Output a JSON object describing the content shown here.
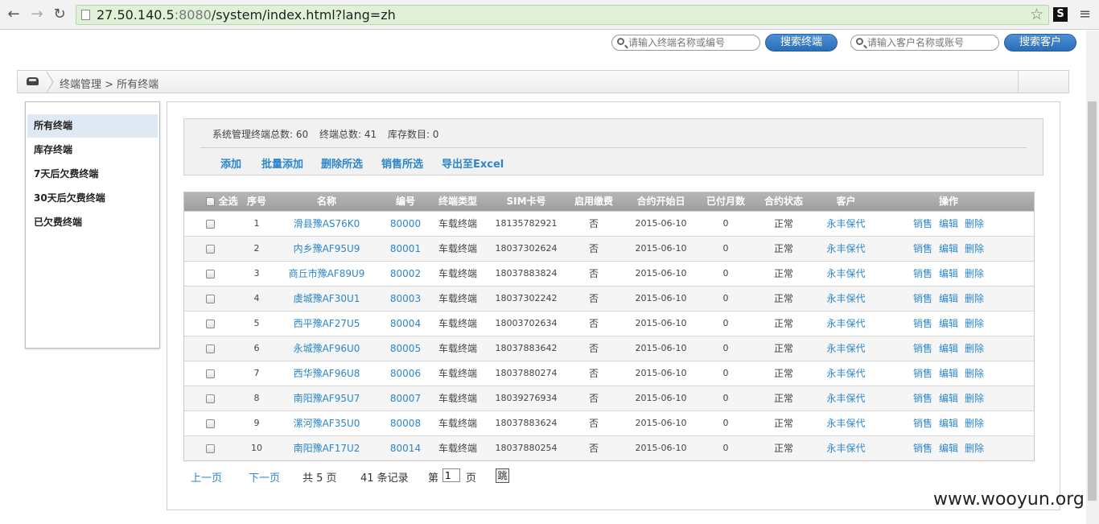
{
  "browser": {
    "url_host": "27.50.140.5",
    "url_port": ":8080",
    "url_path": "/system/index.html?lang=zh",
    "back": "←",
    "forward": "→",
    "reload": "↻",
    "star": "☆",
    "ext": "S",
    "menu": "≡"
  },
  "search": {
    "terminal_placeholder": "请输入终端名称或编号",
    "terminal_button": "搜索终端",
    "customer_placeholder": "请输入客户名称或账号",
    "customer_button": "搜索客户"
  },
  "breadcrumb": {
    "text": "终端管理 > 所有终端"
  },
  "sidebar": {
    "items": [
      {
        "label": "所有终端",
        "active": true
      },
      {
        "label": "库存终端"
      },
      {
        "label": "7天后欠费终端"
      },
      {
        "label": "30天后欠费终端"
      },
      {
        "label": "已欠费终端"
      }
    ]
  },
  "stats": {
    "managed_total": "系统管理终端总数: 60",
    "terminal_total": "终端总数: 41",
    "stock_total": "库存数目: 0"
  },
  "actions": [
    "添加",
    "批量添加",
    "删除所选",
    "销售所选",
    "导出至Excel"
  ],
  "table": {
    "headers": [
      "全选",
      "序号",
      "名称",
      "编号",
      "终端类型",
      "SIM卡号",
      "启用缴费",
      "合约开始日",
      "已付月数",
      "合约状态",
      "客户",
      "操作"
    ],
    "row_ops": [
      "销售",
      "编辑",
      "删除"
    ],
    "rows": [
      [
        "1",
        "滑县豫AS76K0",
        "80000",
        "车载终端",
        "18135782921",
        "否",
        "2015-06-10",
        "0",
        "正常",
        "永丰保代"
      ],
      [
        "2",
        "内乡豫AF95U9",
        "80001",
        "车载终端",
        "18037302624",
        "否",
        "2015-06-10",
        "0",
        "正常",
        "永丰保代"
      ],
      [
        "3",
        "商丘市豫AF89U9",
        "80002",
        "车载终端",
        "18037883824",
        "否",
        "2015-06-10",
        "0",
        "正常",
        "永丰保代"
      ],
      [
        "4",
        "虞城豫AF30U1",
        "80003",
        "车载终端",
        "18037302242",
        "否",
        "2015-06-10",
        "0",
        "正常",
        "永丰保代"
      ],
      [
        "5",
        "西平豫AF27U5",
        "80004",
        "车载终端",
        "18003702634",
        "否",
        "2015-06-10",
        "0",
        "正常",
        "永丰保代"
      ],
      [
        "6",
        "永城豫AF96U0",
        "80005",
        "车载终端",
        "18037883642",
        "否",
        "2015-06-10",
        "0",
        "正常",
        "永丰保代"
      ],
      [
        "7",
        "西华豫AF96U8",
        "80006",
        "车载终端",
        "18037880274",
        "否",
        "2015-06-10",
        "0",
        "正常",
        "永丰保代"
      ],
      [
        "8",
        "南阳豫AF95U7",
        "80007",
        "车载终端",
        "18039276934",
        "否",
        "2015-06-10",
        "0",
        "正常",
        "永丰保代"
      ],
      [
        "9",
        "漯河豫AF35U0",
        "80008",
        "车载终端",
        "18037883624",
        "否",
        "2015-06-10",
        "0",
        "正常",
        "永丰保代"
      ],
      [
        "10",
        "南阳豫AF17U2",
        "80014",
        "车载终端",
        "18037880254",
        "否",
        "2015-06-10",
        "0",
        "正常",
        "永丰保代"
      ]
    ]
  },
  "pagination": {
    "prev": "上一页",
    "next": "下一页",
    "total_pages": "共 5 页",
    "total_records": "41 条记录",
    "page_prefix": "第",
    "current_page": "1",
    "page_suffix": "页",
    "jump": "跳"
  },
  "watermark": "www.wooyun.org"
}
